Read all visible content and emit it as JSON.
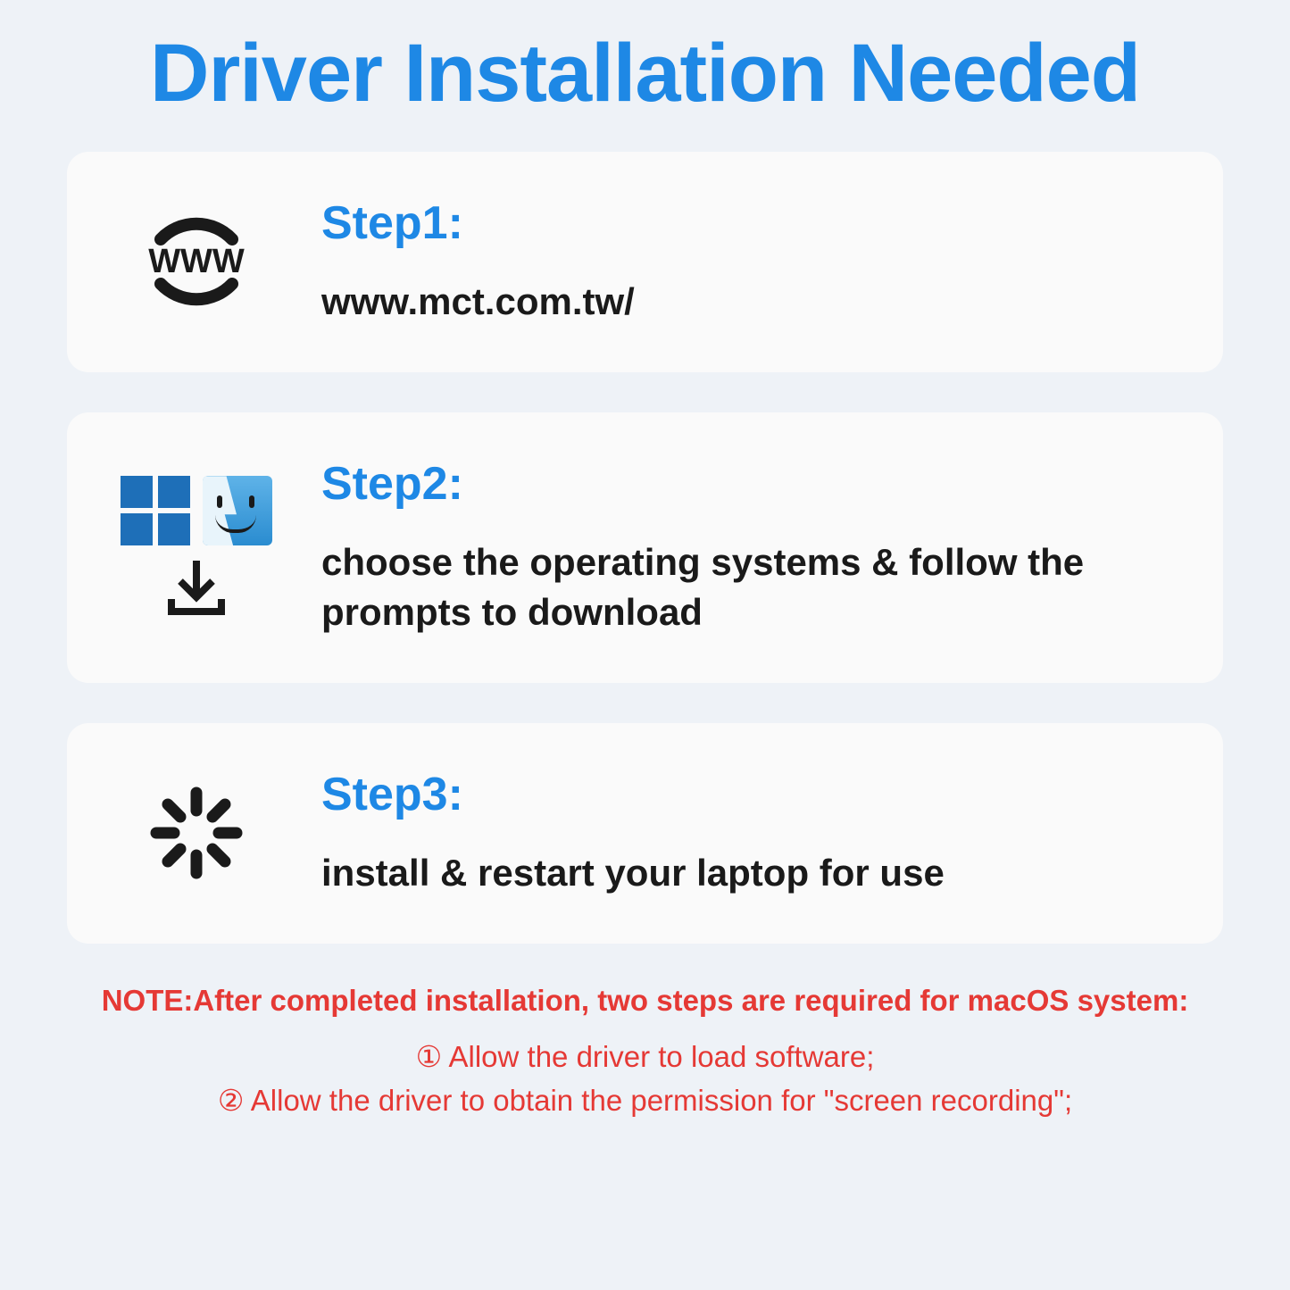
{
  "title": "Driver Installation Needed",
  "steps": [
    {
      "heading": "Step1:",
      "desc": "www.mct.com.tw/",
      "icon": "www-icon"
    },
    {
      "heading": "Step2:",
      "desc": "choose the operating systems & follow the prompts to download",
      "icon": "os-download-icon"
    },
    {
      "heading": "Step3:",
      "desc": "install & restart your laptop for use",
      "icon": "loading-icon"
    }
  ],
  "note": {
    "heading": "NOTE:After completed installation, two steps are required for macOS system:",
    "items": [
      "① Allow the driver to load software;",
      "② Allow the driver to obtain the permission for \"screen recording\";"
    ]
  }
}
